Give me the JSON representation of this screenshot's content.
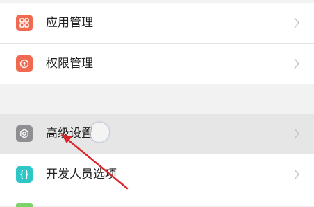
{
  "settings": {
    "items": [
      {
        "label": "应用管理",
        "icon": "app-grid-icon",
        "color": "#f06a4f"
      },
      {
        "label": "权限管理",
        "icon": "permission-shield-icon",
        "color": "#f06a4f"
      },
      {
        "label": "高级设置",
        "icon": "gear-icon",
        "color": "#8e8e93"
      },
      {
        "label": "开发人员选项",
        "icon": "braces-icon",
        "color": "#2fc6c8"
      }
    ]
  },
  "colors": {
    "background": "#f2f2f2",
    "annotation_arrow": "#d9262c",
    "pressed_row": "#e6e6e6"
  }
}
